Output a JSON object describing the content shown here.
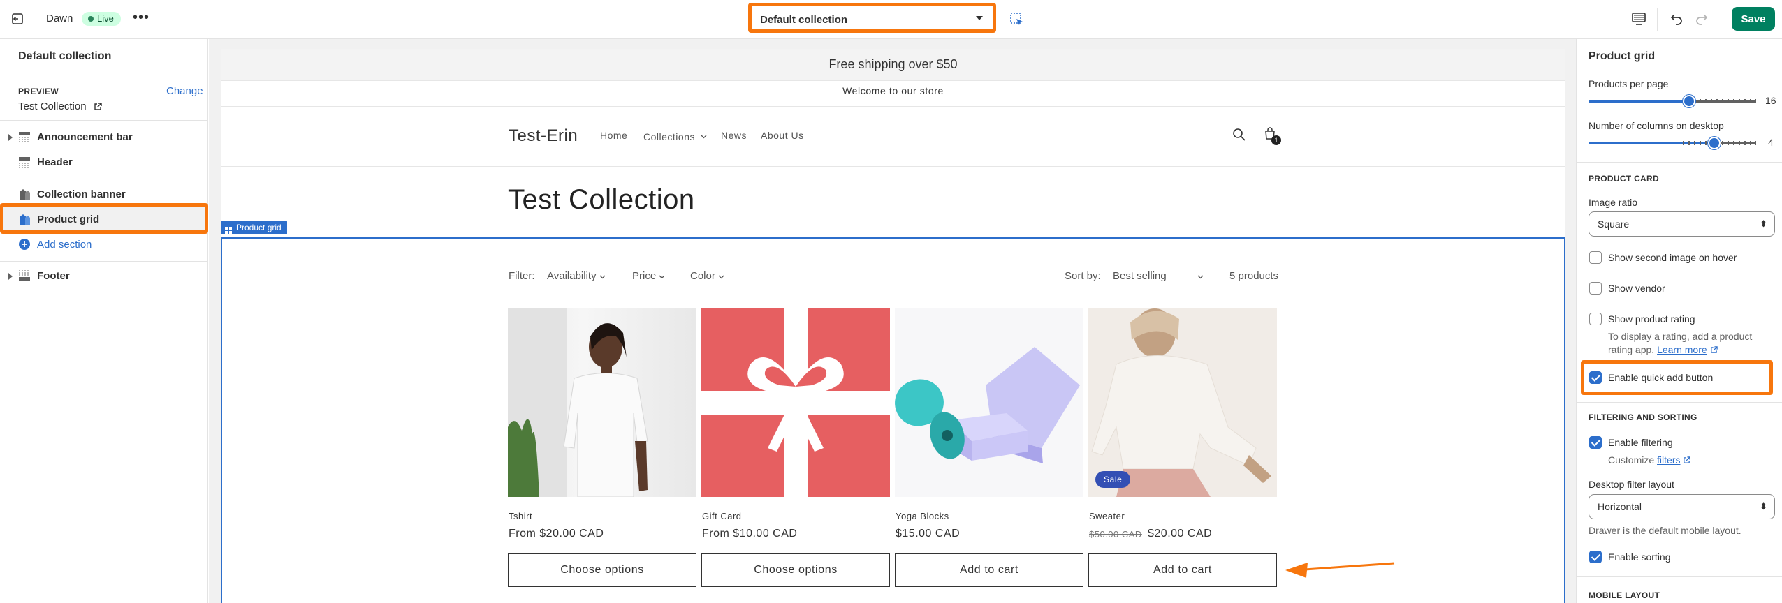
{
  "topbar": {
    "theme_name": "Dawn",
    "live_label": "Live",
    "template_select": "Default collection",
    "save_label": "Save"
  },
  "left": {
    "title": "Default collection",
    "preview_label": "PREVIEW",
    "change_label": "Change",
    "preview_value": "Test Collection",
    "sections": [
      {
        "label": "Announcement bar"
      },
      {
        "label": "Header"
      },
      {
        "label": "Collection banner"
      },
      {
        "label": "Product grid"
      },
      {
        "label": "Add section"
      },
      {
        "label": "Footer"
      }
    ]
  },
  "store": {
    "shipping_bar": "Free shipping over $50",
    "welcome": "Welcome to our store",
    "logo": "Test-Erin",
    "nav": [
      "Home",
      "Collections",
      "News",
      "About Us"
    ],
    "cart_count": "1",
    "collection_title": "Test Collection",
    "section_tag": "Product grid",
    "filter_label": "Filter:",
    "filters": [
      "Availability",
      "Price",
      "Color"
    ],
    "sort_label": "Sort by:",
    "sort_value": "Best selling",
    "product_count": "5 products",
    "products": [
      {
        "title": "Tshirt",
        "price": "From $20.00 CAD",
        "compare": "",
        "button": "Choose options"
      },
      {
        "title": "Gift Card",
        "price": "From $10.00 CAD",
        "compare": "",
        "button": "Choose options"
      },
      {
        "title": "Yoga Blocks",
        "price": "$15.00 CAD",
        "compare": "",
        "button": "Add to cart"
      },
      {
        "title": "Sweater",
        "price": "$20.00 CAD",
        "compare": "$50.00 CAD",
        "button": "Add to cart",
        "badge": "Sale"
      }
    ]
  },
  "right": {
    "title": "Product grid",
    "per_page_label": "Products per page",
    "per_page_value": "16",
    "per_page_fraction": 0.6,
    "columns_label": "Number of columns on desktop",
    "columns_value": "4",
    "columns_fraction": 0.75,
    "product_card_heading": "PRODUCT CARD",
    "image_ratio_label": "Image ratio",
    "image_ratio_value": "Square",
    "second_image": "Show second image on hover",
    "show_vendor": "Show vendor",
    "show_rating": "Show product rating",
    "rating_help": "To display a rating, add a product rating app.",
    "learn_more": "Learn more",
    "quick_add": "Enable quick add button",
    "filtering_heading": "FILTERING AND SORTING",
    "enable_filtering": "Enable filtering",
    "customize": "Customize",
    "filters_link": "filters",
    "filter_layout_label": "Desktop filter layout",
    "filter_layout_value": "Horizontal",
    "drawer_help": "Drawer is the default mobile layout.",
    "enable_sorting": "Enable sorting",
    "mobile_heading": "MOBILE LAYOUT"
  },
  "colors": {
    "accent": "#2c6ecb",
    "highlight": "#f7760d",
    "save": "#008060",
    "gift": "#e65f61"
  }
}
